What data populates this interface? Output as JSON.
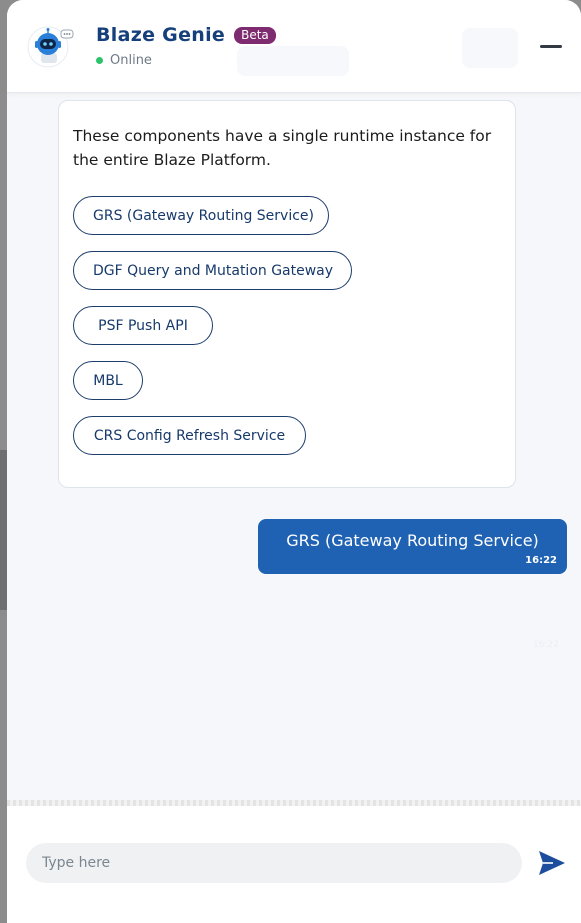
{
  "header": {
    "bot_name": "Blaze Genie",
    "badge": "Beta",
    "status": "Online",
    "avatar_icon": "robot-icon",
    "minimize_icon": "minimize-icon"
  },
  "bot_message": {
    "text": "These components have a single runtime instance for the entire Blaze Platform.",
    "options": [
      "GRS (Gateway Routing Service)",
      "DGF Query and Mutation Gateway",
      "PSF Push API",
      "MBL",
      "CRS Config Refresh Service"
    ]
  },
  "user_message": {
    "text": "GRS (Gateway Routing Service)",
    "time": "16:22"
  },
  "faint_time": "16:22",
  "composer": {
    "placeholder": "Type here",
    "send_icon": "send-icon"
  },
  "colors": {
    "brand_navy": "#15407b",
    "beta_badge": "#7e2b6f",
    "online_green": "#2ec26d",
    "user_bubble": "#1f62b4",
    "send_icon": "#1d4e9e"
  }
}
